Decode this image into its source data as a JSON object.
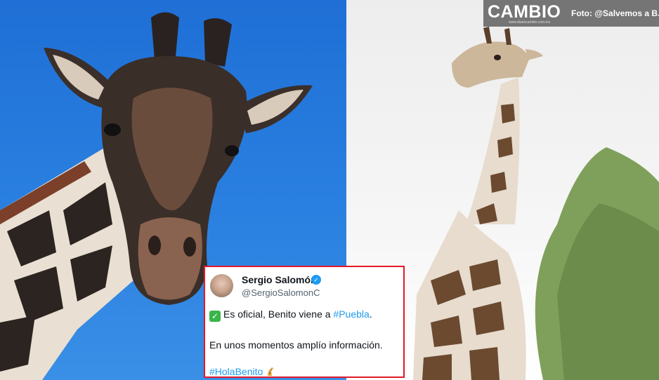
{
  "watermark": {
    "logo": "CAMBIO",
    "subtext": "www.diariocambio.com.mx",
    "credit": "Foto: @Salvemos a B."
  },
  "photos": {
    "left": {
      "icon": "giraffe-closeup-photo",
      "sky_color": "#2a80e0"
    },
    "right": {
      "icon": "giraffe-full-photo",
      "tree_color": "#7fa05a"
    }
  },
  "tweet": {
    "author_name": "Sergio Salomón",
    "handle": "@SergioSalomonC",
    "line1_prefix": "Es oficial, Benito viene a ",
    "line1_hashtag": "#Puebla",
    "line1_suffix": ".",
    "line2": "En unos momentos amplío información.",
    "hashtag": "#HolaBenito",
    "verified_icon": "verified-badge-icon",
    "check_icon": "check-mark-icon",
    "emoji_icon": "giraffe-emoji-icon",
    "border_color": "#e0192a"
  }
}
